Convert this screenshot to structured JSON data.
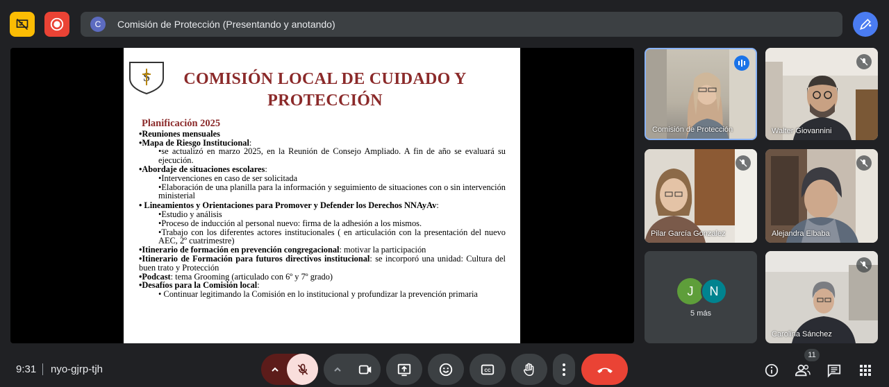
{
  "header": {
    "presenter_initial": "C",
    "presentation_title": "Comisión de Protección (Presentando y anotando)"
  },
  "slide": {
    "logo_text": "S4R",
    "title_line1": "COMISIÓN LOCAL DE CUIDADO Y",
    "title_line2": "PROTECCIÓN",
    "planificacion": "Planificación 2025",
    "items": {
      "reuniones": "•Reuniones mensuales",
      "mapa_bold": "•Mapa de Riesgo Institucional",
      "mapa_rest": ":",
      "mapa_sub": "•se actualizó en marzo 2025, en la Reunión de Consejo Ampliado. A fin de año se evaluará su ejecución.",
      "abordaje_bold": "•Abordaje de situaciones escolares",
      "abordaje_rest": ":",
      "abordaje_sub1": "•Intervenciones en caso de ser solicitada",
      "abordaje_sub2": "•Elaboración de una planilla para  la información y seguimiento de situaciones con o sin intervención ministerial",
      "lineamientos_bold": "• Lineamientos y Orientaciones para Promover y Defender los Derechos NNAyAv",
      "lineamientos_rest": ":",
      "lin_sub1": "•Estudio y análisis",
      "lin_sub2": "•Proceso de inducción al personal nuevo: firma de la adhesión a los mismos.",
      "lin_sub3": "•Trabajo con los diferentes actores institucionales ( en articulación con la presentación del nuevo AEC, 2º cuatrimestre)",
      "itin1_bold": "•Itinerario de formación en prevención congregacional",
      "itin1_rest": ": motivar la participación",
      "itin2_bold": "•Itinerario de Formación para futuros directivos institucional",
      "itin2_rest": ": se incorporó una unidad: Cultura del buen trato y Protección",
      "podcast_bold": "•Podcast",
      "podcast_rest": ": tema Grooming (articulado con 6º y 7º grado)",
      "desafios_bold": "•Desafíos para la Comisión local",
      "desafios_rest": ":",
      "desafios_sub": "• Continuar legitimando la Comisión en lo institucional y profundizar la prevención primaria"
    }
  },
  "participants": [
    {
      "name": "Comisión de Protección",
      "state": "speaking"
    },
    {
      "name": "Walter Giovannini",
      "state": "muted"
    },
    {
      "name": "Pilar García Gonzalez",
      "state": "muted"
    },
    {
      "name": "Alejandra Elbaba",
      "state": "muted"
    },
    {
      "name": "Carolina Sánchez",
      "state": "muted"
    }
  ],
  "more": {
    "avatar1": "J",
    "avatar2": "N",
    "avatar1_color": "#5e9e3a",
    "avatar2_color": "#00838f",
    "label": "5 más"
  },
  "bottom": {
    "time": "9:31",
    "meeting_code": "nyo-gjrp-tjh",
    "people_count": "11"
  },
  "colors": {
    "accent_red": "#ea4335",
    "accent_blue": "#1a73e8",
    "yellow": "#fbbc04",
    "slide_title": "#8b2a2a"
  }
}
